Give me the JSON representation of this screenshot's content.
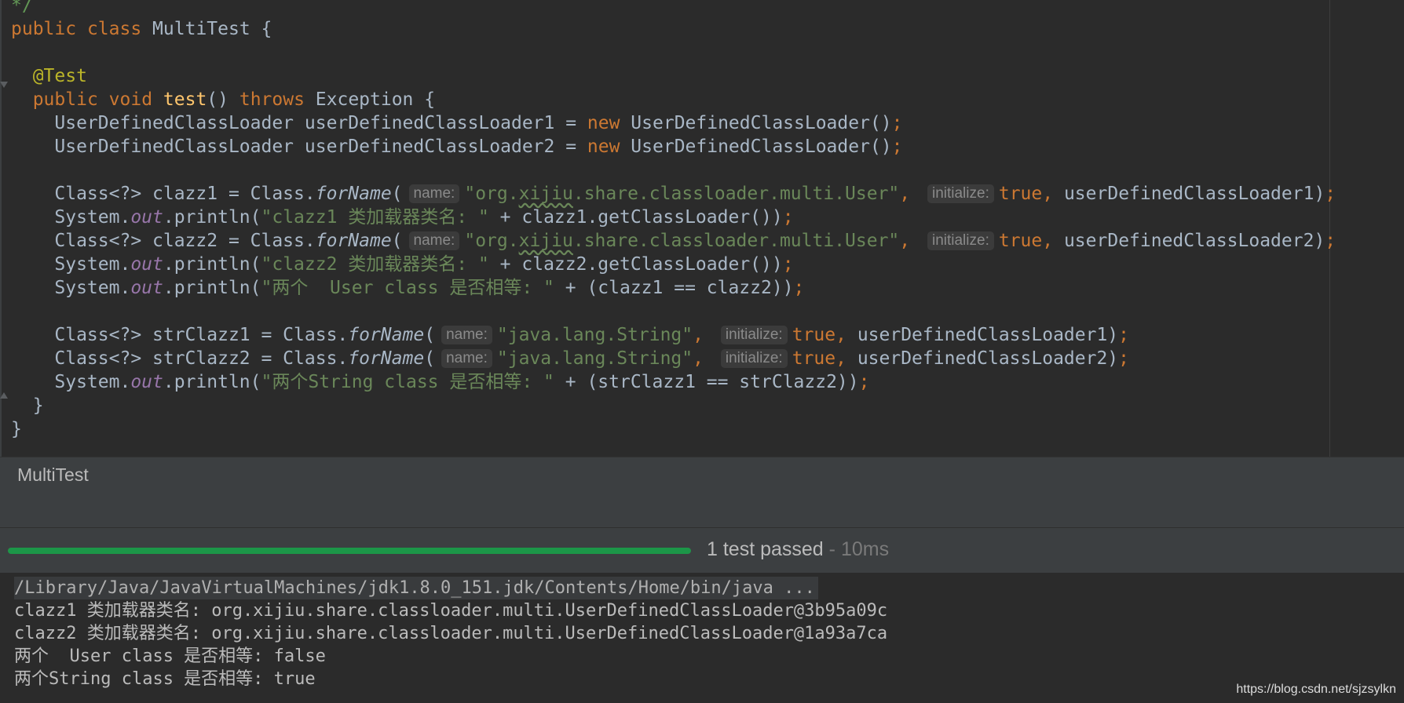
{
  "editor": {
    "lines": [
      {
        "tokens": [
          {
            "t": "*/",
            "c": "cm"
          }
        ]
      },
      {
        "tokens": [
          {
            "t": "public",
            "c": "kw"
          },
          {
            "t": " "
          },
          {
            "t": "class",
            "c": "kw"
          },
          {
            "t": " MultiTest {"
          }
        ]
      },
      {
        "tokens": []
      },
      {
        "tokens": [
          {
            "t": "  "
          },
          {
            "t": "@Test",
            "c": "ann"
          }
        ]
      },
      {
        "tokens": [
          {
            "t": "  "
          },
          {
            "t": "public",
            "c": "kw"
          },
          {
            "t": " "
          },
          {
            "t": "void",
            "c": "kw"
          },
          {
            "t": " "
          },
          {
            "t": "test",
            "c": "fn"
          },
          {
            "t": "() "
          },
          {
            "t": "throws",
            "c": "kw"
          },
          {
            "t": " Exception {"
          }
        ]
      },
      {
        "tokens": [
          {
            "t": "    UserDefinedClassLoader userDefinedClassLoader1 = "
          },
          {
            "t": "new",
            "c": "kw"
          },
          {
            "t": " UserDefinedClassLoader()"
          },
          {
            "t": ";",
            "c": "kw"
          }
        ]
      },
      {
        "tokens": [
          {
            "t": "    UserDefinedClassLoader userDefinedClassLoader2 = "
          },
          {
            "t": "new",
            "c": "kw"
          },
          {
            "t": " UserDefinedClassLoader()"
          },
          {
            "t": ";",
            "c": "kw"
          }
        ]
      },
      {
        "tokens": []
      },
      {
        "tokens": [
          {
            "t": "    Class<?> clazz1 = Class."
          },
          {
            "t": "forName",
            "c": "itl"
          },
          {
            "t": "("
          },
          {
            "t": "name:",
            "c": "hint"
          },
          {
            "t": "\"org.",
            "c": "str"
          },
          {
            "t": "xijiu",
            "c": "str squig"
          },
          {
            "t": ".share.classloader.multi.User\"",
            "c": "str"
          },
          {
            "t": ",",
            "c": "kw"
          },
          {
            "t": " "
          },
          {
            "t": "initialize:",
            "c": "hint"
          },
          {
            "t": "true",
            "c": "kw"
          },
          {
            "t": ",",
            "c": "kw"
          },
          {
            "t": " userDefinedClassLoader1)"
          },
          {
            "t": ";",
            "c": "kw"
          }
        ]
      },
      {
        "tokens": [
          {
            "t": "    System."
          },
          {
            "t": "out",
            "c": "fld"
          },
          {
            "t": ".println("
          },
          {
            "t": "\"clazz1 类加载器类名: \"",
            "c": "str"
          },
          {
            "t": " + clazz1.getClassLoader())"
          },
          {
            "t": ";",
            "c": "kw"
          }
        ]
      },
      {
        "tokens": [
          {
            "t": "    Class<?> clazz2 = Class."
          },
          {
            "t": "forName",
            "c": "itl"
          },
          {
            "t": "("
          },
          {
            "t": "name:",
            "c": "hint"
          },
          {
            "t": "\"org.",
            "c": "str"
          },
          {
            "t": "xijiu",
            "c": "str squig"
          },
          {
            "t": ".share.classloader.multi.User\"",
            "c": "str"
          },
          {
            "t": ",",
            "c": "kw"
          },
          {
            "t": " "
          },
          {
            "t": "initialize:",
            "c": "hint"
          },
          {
            "t": "true",
            "c": "kw"
          },
          {
            "t": ",",
            "c": "kw"
          },
          {
            "t": " userDefinedClassLoader2)"
          },
          {
            "t": ";",
            "c": "kw"
          }
        ]
      },
      {
        "tokens": [
          {
            "t": "    System."
          },
          {
            "t": "out",
            "c": "fld"
          },
          {
            "t": ".println("
          },
          {
            "t": "\"clazz2 类加载器类名: \"",
            "c": "str"
          },
          {
            "t": " + clazz2.getClassLoader())"
          },
          {
            "t": ";",
            "c": "kw"
          }
        ]
      },
      {
        "tokens": [
          {
            "t": "    System."
          },
          {
            "t": "out",
            "c": "fld"
          },
          {
            "t": ".println("
          },
          {
            "t": "\"两个  User class 是否相等: \"",
            "c": "str"
          },
          {
            "t": " + (clazz1 == clazz2))"
          },
          {
            "t": ";",
            "c": "kw"
          }
        ]
      },
      {
        "tokens": []
      },
      {
        "tokens": [
          {
            "t": "    Class<?> strClazz1 = Class."
          },
          {
            "t": "forName",
            "c": "itl"
          },
          {
            "t": "("
          },
          {
            "t": "name:",
            "c": "hint"
          },
          {
            "t": "\"java.lang.String\"",
            "c": "str"
          },
          {
            "t": ",",
            "c": "kw"
          },
          {
            "t": " "
          },
          {
            "t": "initialize:",
            "c": "hint"
          },
          {
            "t": "true",
            "c": "kw"
          },
          {
            "t": ",",
            "c": "kw"
          },
          {
            "t": " userDefinedClassLoader1)"
          },
          {
            "t": ";",
            "c": "kw"
          }
        ]
      },
      {
        "tokens": [
          {
            "t": "    Class<?> strClazz2 = Class."
          },
          {
            "t": "forName",
            "c": "itl"
          },
          {
            "t": "("
          },
          {
            "t": "name:",
            "c": "hint"
          },
          {
            "t": "\"java.lang.String\"",
            "c": "str"
          },
          {
            "t": ",",
            "c": "kw"
          },
          {
            "t": " "
          },
          {
            "t": "initialize:",
            "c": "hint"
          },
          {
            "t": "true",
            "c": "kw"
          },
          {
            "t": ",",
            "c": "kw"
          },
          {
            "t": " userDefinedClassLoader2)"
          },
          {
            "t": ";",
            "c": "kw"
          }
        ]
      },
      {
        "tokens": [
          {
            "t": "    System."
          },
          {
            "t": "out",
            "c": "fld"
          },
          {
            "t": ".println("
          },
          {
            "t": "\"两个String class 是否相等: \"",
            "c": "str"
          },
          {
            "t": " + (strClazz1 == strClazz2))"
          },
          {
            "t": ";",
            "c": "kw"
          }
        ]
      },
      {
        "tokens": [
          {
            "t": "  }"
          }
        ]
      },
      {
        "tokens": [
          {
            "t": "}"
          }
        ]
      }
    ]
  },
  "run_panel": {
    "title": "MultiTest",
    "status": {
      "passed_text": "1 test passed",
      "separator": " - ",
      "duration": "10ms",
      "progress_fraction": 1.0,
      "progress_color": "#1c9648"
    }
  },
  "console": {
    "command": "/Library/Java/JavaVirtualMachines/jdk1.8.0_151.jdk/Contents/Home/bin/java ...",
    "output": [
      "clazz1 类加载器类名: org.xijiu.share.classloader.multi.UserDefinedClassLoader@3b95a09c",
      "clazz2 类加载器类名: org.xijiu.share.classloader.multi.UserDefinedClassLoader@1a93a7ca",
      "两个  User class 是否相等: false",
      "两个String class 是否相等: true"
    ]
  },
  "watermark": "https://blog.csdn.net/sjzsylkn",
  "colors": {
    "keyword": "#cc7832",
    "string": "#6a8759",
    "annotation": "#bbb529",
    "method": "#ffc66d",
    "static_field": "#9876aa",
    "text": "#a9b7c6",
    "background": "#2b2b2b"
  }
}
